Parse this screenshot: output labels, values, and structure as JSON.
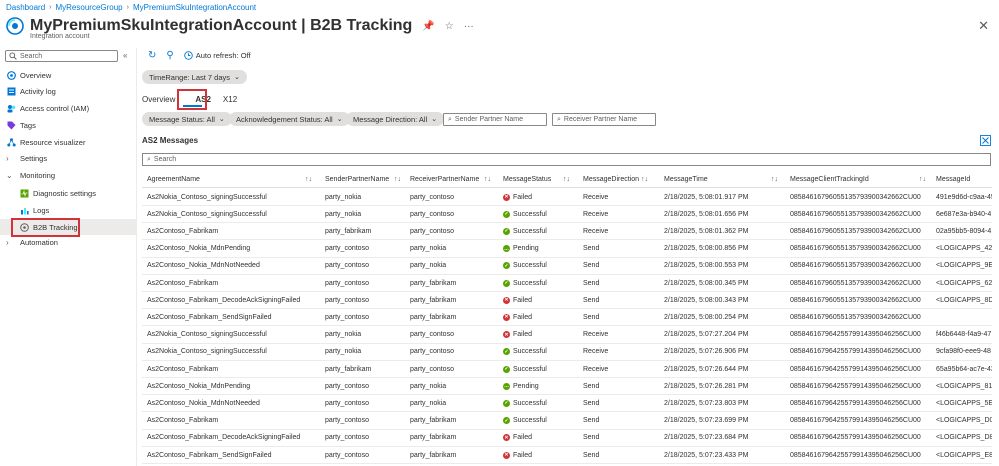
{
  "breadcrumb": [
    "Dashboard",
    "MyResourceGroup",
    "MyPremiumSkuIntegrationAccount"
  ],
  "title": "MyPremiumSkuIntegrationAccount | B2B Tracking",
  "subtitle": "Integration account",
  "nav": {
    "search_placeholder": "Search",
    "items": [
      {
        "label": "Overview",
        "icon": "overview-icon"
      },
      {
        "label": "Activity log",
        "icon": "activity-log-icon"
      },
      {
        "label": "Access control (IAM)",
        "icon": "iam-icon"
      },
      {
        "label": "Tags",
        "icon": "tag-icon"
      },
      {
        "label": "Resource visualizer",
        "icon": "visualizer-icon"
      },
      {
        "label": "Settings",
        "icon": "chevron-right-icon"
      },
      {
        "label": "Monitoring",
        "icon": "chevron-down-icon"
      },
      {
        "label": "Diagnostic settings",
        "icon": "diagnostic-icon"
      },
      {
        "label": "Logs",
        "icon": "logs-icon"
      },
      {
        "label": "B2B Tracking",
        "icon": "b2b-tracking-icon"
      },
      {
        "label": "Automation",
        "icon": "chevron-right-icon"
      }
    ]
  },
  "toolbar": {
    "auto_refresh": "Auto refresh: Off"
  },
  "time_range": "TimeRange: Last 7 days",
  "tabs": [
    "Overview",
    "AS2",
    "X12"
  ],
  "filters": {
    "message_status": "Message Status: All",
    "ack_status": "Acknowledgement Status: All",
    "direction": "Message Direction: All",
    "sender_placeholder": "Sender Partner Name",
    "receiver_placeholder": "Receiver Partner Name"
  },
  "section_title": "AS2 Messages",
  "grid_search_placeholder": "Search",
  "columns": [
    "AgreementName",
    "SenderPartnerName",
    "ReceiverPartnerName",
    "MessageStatus",
    "MessageDirection",
    "MessageTime",
    "MessageClientTrackingId",
    "MessageId"
  ],
  "rows": [
    [
      "As2Nokia_Contoso_signingSuccessful",
      "party_nokia",
      "party_contoso",
      "Failed",
      "Receive",
      "2/18/2025, 5:08:01.917 PM",
      "08584616796055135793900342662CU00",
      "491e9d6d-c9aa-45"
    ],
    [
      "As2Nokia_Contoso_signingSuccessful",
      "party_nokia",
      "party_contoso",
      "Successful",
      "Receive",
      "2/18/2025, 5:08:01.656 PM",
      "08584616796055135793900342662CU00",
      "6e687e3a-b940-4"
    ],
    [
      "As2Contoso_Fabrikam",
      "party_fabrikam",
      "party_contoso",
      "Successful",
      "Receive",
      "2/18/2025, 5:08:01.362 PM",
      "08584616796055135793900342662CU00",
      "02a95bb5-8094-4"
    ],
    [
      "As2Contoso_Nokia_MdnPending",
      "party_contoso",
      "party_nokia",
      "Pending",
      "Send",
      "2/18/2025, 5:08:00.856 PM",
      "08584616796055135793900342662CU00",
      "<LOGICAPPS_42D"
    ],
    [
      "As2Contoso_Nokia_MdnNotNeeded",
      "party_contoso",
      "party_nokia",
      "Successful",
      "Send",
      "2/18/2025, 5:08:00.553 PM",
      "08584616796055135793900342662CU00",
      "<LOGICAPPS_9E8"
    ],
    [
      "As2Contoso_Fabrikam",
      "party_contoso",
      "party_fabrikam",
      "Successful",
      "Send",
      "2/18/2025, 5:08:00.345 PM",
      "08584616796055135793900342662CU00",
      "<LOGICAPPS_627"
    ],
    [
      "As2Contoso_Fabrikam_DecodeAckSigningFailed",
      "party_contoso",
      "party_fabrikam",
      "Failed",
      "Send",
      "2/18/2025, 5:08:00.343 PM",
      "08584616796055135793900342662CU00",
      "<LOGICAPPS_8D8"
    ],
    [
      "As2Contoso_Fabrikam_SendSignFailed",
      "party_contoso",
      "party_fabrikam",
      "Failed",
      "Send",
      "2/18/2025, 5:08:00.254 PM",
      "08584616796055135793900342662CU00",
      ""
    ],
    [
      "As2Nokia_Contoso_signingSuccessful",
      "party_nokia",
      "party_contoso",
      "Failed",
      "Receive",
      "2/18/2025, 5:07:27.204 PM",
      "08584616796425579914395046256CU00",
      "f46b6448-f4a9-47"
    ],
    [
      "As2Nokia_Contoso_signingSuccessful",
      "party_nokia",
      "party_contoso",
      "Successful",
      "Receive",
      "2/18/2025, 5:07:26.906 PM",
      "08584616796425579914395046256CU00",
      "9cfa98f0-eee9-48"
    ],
    [
      "As2Contoso_Fabrikam",
      "party_fabrikam",
      "party_contoso",
      "Successful",
      "Receive",
      "2/18/2025, 5:07:26.644 PM",
      "08584616796425579914395046256CU00",
      "65a95b64-ac7e-43"
    ],
    [
      "As2Contoso_Nokia_MdnPending",
      "party_contoso",
      "party_nokia",
      "Pending",
      "Send",
      "2/18/2025, 5:07:26.281 PM",
      "08584616796425579914395046256CU00",
      "<LOGICAPPS_816"
    ],
    [
      "As2Contoso_Nokia_MdnNotNeeded",
      "party_contoso",
      "party_nokia",
      "Successful",
      "Send",
      "2/18/2025, 5:07:23.803 PM",
      "08584616796425579914395046256CU00",
      "<LOGICAPPS_5E2"
    ],
    [
      "As2Contoso_Fabrikam",
      "party_contoso",
      "party_fabrikam",
      "Successful",
      "Send",
      "2/18/2025, 5:07:23.699 PM",
      "08584616796425579914395046256CU00",
      "<LOGICAPPS_D00"
    ],
    [
      "As2Contoso_Fabrikam_DecodeAckSigningFailed",
      "party_contoso",
      "party_fabrikam",
      "Failed",
      "Send",
      "2/18/2025, 5:07:23.684 PM",
      "08584616796425579914395046256CU00",
      "<LOGICAPPS_D8A"
    ],
    [
      "As2Contoso_Fabrikam_SendSignFailed",
      "party_contoso",
      "party_fabrikam",
      "Failed",
      "Send",
      "2/18/2025, 5:07:23.433 PM",
      "08584616796425579914395046256CU00",
      "<LOGICAPPS_E89"
    ]
  ],
  "colors": {
    "accent": "#0078d4",
    "failed": "#d13438",
    "success": "#57a300",
    "highlight": "#d13438"
  }
}
